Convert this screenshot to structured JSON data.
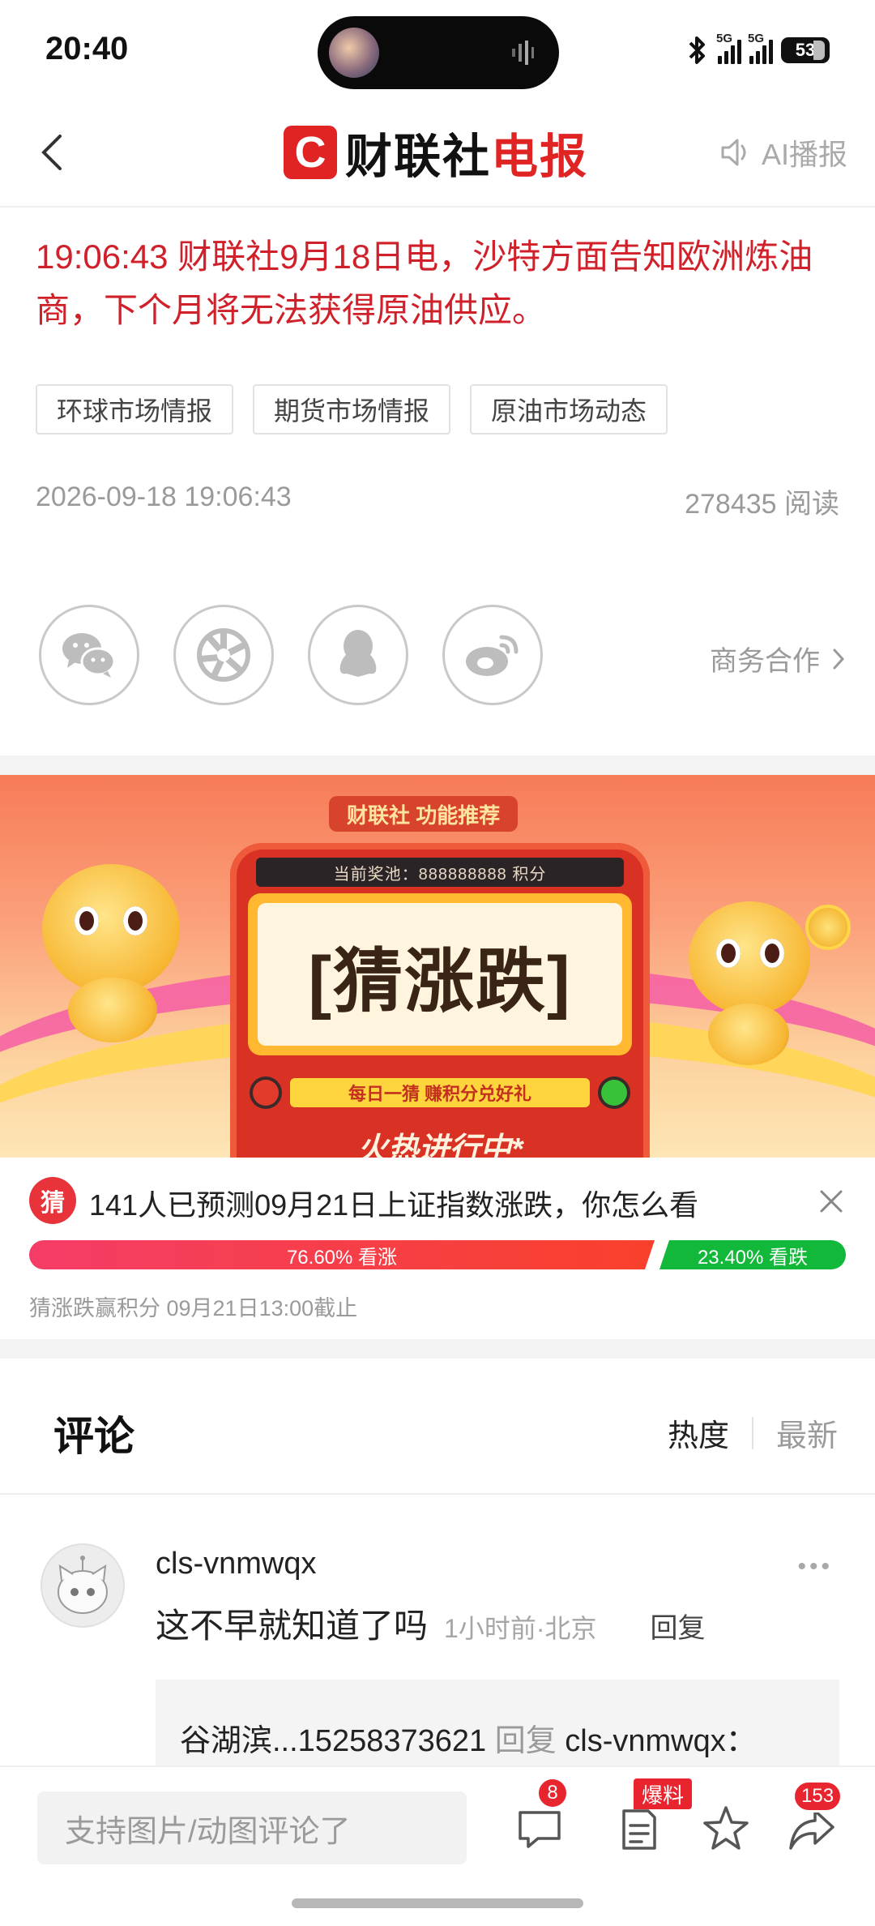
{
  "status": {
    "time": "20:40",
    "signal1": "5G",
    "signal2": "5G",
    "battery": "53"
  },
  "nav": {
    "brand_badge": "C",
    "brand_name": "财联社",
    "brand_suffix": "电报",
    "ai_label": "AI播报"
  },
  "article": {
    "headline": "19:06:43  财联社9月18日电，沙特方面告知欧洲炼油商，下个月将无法获得原油供应。",
    "tags": [
      "环球市场情报",
      "期货市场情报",
      "原油市场动态"
    ],
    "datetime": "2026-09-18 19:06:43",
    "reads": "278435 阅读"
  },
  "share": {
    "icons": [
      "wechat-icon",
      "moments-icon",
      "qq-icon",
      "weibo-icon"
    ],
    "business_label": "商务合作"
  },
  "banner": {
    "feature_tag": "财联社  功能推荐",
    "prize_pool": "当前奖池：888888888 积分",
    "game_title": "[猜涨跌]",
    "slogan": "每日一猜 赚积分兑好礼",
    "status_text": "火热进行中*"
  },
  "poll": {
    "icon_label": "猜",
    "title": "141人已预测09月21日上证指数涨跌，你怎么看",
    "up_label": "76.60% 看涨",
    "up_fraction": 0.766,
    "down_label": "23.40% 看跌",
    "subtitle": "猜涨跌赢积分  09月21日13:00截止",
    "colors": {
      "up": "#f5413b",
      "down": "#12b83a"
    }
  },
  "comments": {
    "title": "评论",
    "sort_hot": "热度",
    "sort_new": "最新",
    "items": [
      {
        "user": "cls-vnmwqx",
        "text": "这不早就知道了吗",
        "time_location": "1小时前·北京",
        "reply_label": "回复",
        "quote_user": "谷湖滨...15258373621",
        "quote_reply": "回复",
        "quote_target": "cls-vnmwqx："
      }
    ]
  },
  "bottom": {
    "input_placeholder": "支持图片/动图评论了",
    "comment_count": "8",
    "report_badge": "爆料",
    "share_count": "153"
  },
  "accent_color": "#e02424"
}
